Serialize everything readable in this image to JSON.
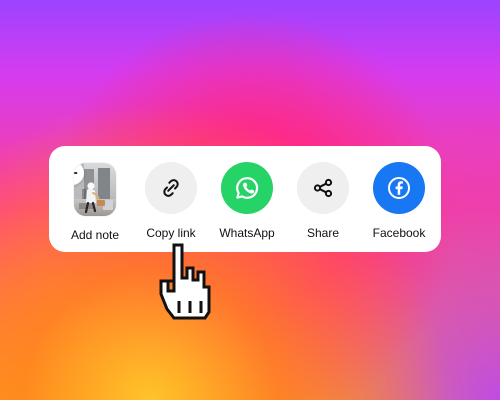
{
  "share_menu": {
    "items": [
      {
        "label": "Add note",
        "icon": "photo-note-icon"
      },
      {
        "label": "Copy link",
        "icon": "link-icon"
      },
      {
        "label": "WhatsApp",
        "icon": "whatsapp-icon"
      },
      {
        "label": "Share",
        "icon": "share-icon"
      },
      {
        "label": "Facebook",
        "icon": "facebook-icon"
      }
    ]
  },
  "colors": {
    "whatsapp": "#25D366",
    "facebook": "#1877F2",
    "icon_background": "#EFEFEF"
  },
  "cursor": {
    "icon": "pointer-hand-cursor"
  }
}
